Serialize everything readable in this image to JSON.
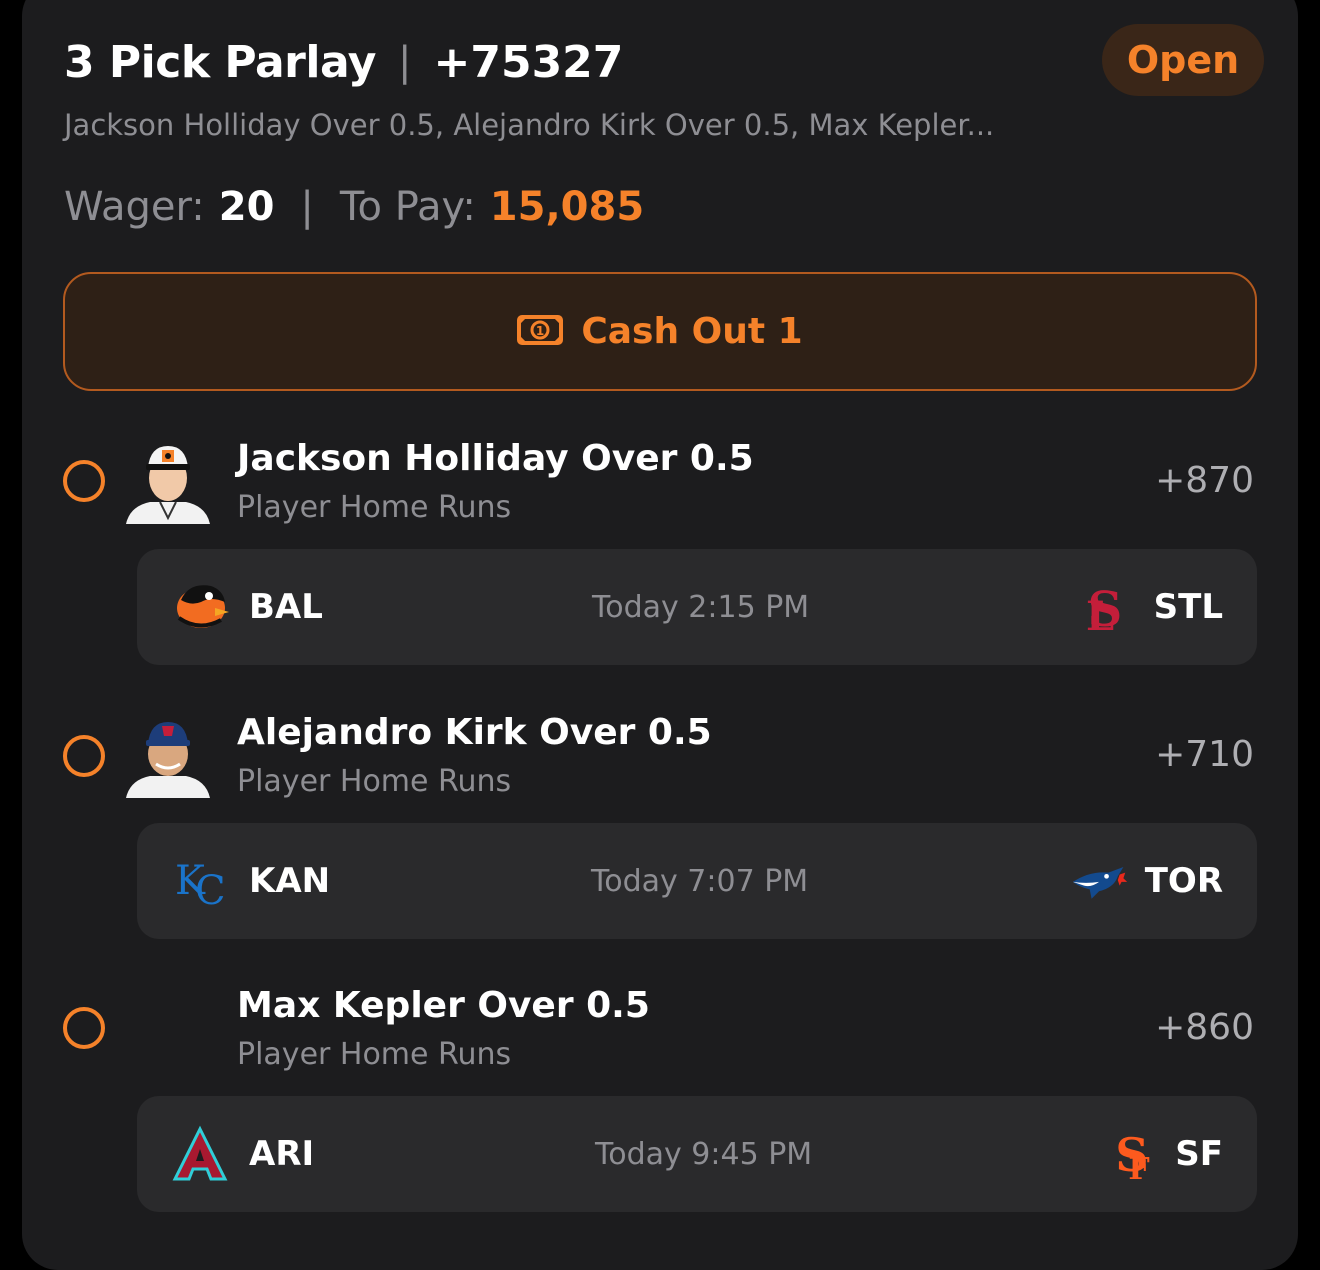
{
  "header": {
    "title": "3 Pick Parlay",
    "separator": "|",
    "odds": "+75327",
    "status": "Open",
    "subtitle": "Jackson Holliday Over 0.5, Alejandro Kirk Over 0.5, Max Kepler..."
  },
  "wager": {
    "wager_label": "Wager:",
    "wager_value": "20",
    "separator": "|",
    "pay_label": "To Pay:",
    "pay_value": "15,085"
  },
  "cashout": {
    "label": "Cash Out 1",
    "icon": "money-bill-icon"
  },
  "legs": [
    {
      "title": "Jackson Holliday Over 0.5",
      "market": "Player Home Runs",
      "odds": "+870",
      "away": {
        "abbr": "BAL",
        "icon": "orioles-logo-icon"
      },
      "time": "Today 2:15 PM",
      "home": {
        "abbr": "STL",
        "icon": "cardinals-logo-icon"
      }
    },
    {
      "title": "Alejandro Kirk Over 0.5",
      "market": "Player Home Runs",
      "odds": "+710",
      "away": {
        "abbr": "KAN",
        "icon": "royals-logo-icon"
      },
      "time": "Today 7:07 PM",
      "home": {
        "abbr": "TOR",
        "icon": "bluejays-logo-icon"
      }
    },
    {
      "title": "Max Kepler Over 0.5",
      "market": "Player Home Runs",
      "odds": "+860",
      "away": {
        "abbr": "ARI",
        "icon": "diamondbacks-logo-icon"
      },
      "time": "Today 9:45 PM",
      "home": {
        "abbr": "SF",
        "icon": "giants-logo-icon"
      }
    }
  ],
  "colors": {
    "accent": "#f5822a",
    "card_bg": "#1c1c1e",
    "game_bg": "#2a2a2c",
    "muted": "#8e8e93"
  }
}
